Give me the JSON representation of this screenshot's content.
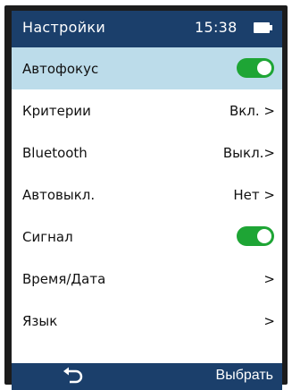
{
  "status": {
    "title": "Настройки",
    "time": "15:38",
    "battery_icon": "battery-icon"
  },
  "menu": [
    {
      "label": "Автофокус",
      "toggle": true,
      "selected": true
    },
    {
      "label": "Критерии",
      "value": "Вкл. >"
    },
    {
      "label": "Bluetooth",
      "value": "Выкл.>"
    },
    {
      "label": "Автовыкл.",
      "value": "Нет >"
    },
    {
      "label": "Сигнал",
      "toggle": true
    },
    {
      "label": "Время/Дата",
      "value": ">"
    },
    {
      "label": "Язык",
      "value": ">"
    }
  ],
  "softkeys": {
    "back_icon": "back-arrow-icon",
    "select_label": "Выбрать"
  },
  "colors": {
    "header": "#1b3f6b",
    "selected_row": "#bcdcea",
    "toggle_on": "#1ea535"
  }
}
